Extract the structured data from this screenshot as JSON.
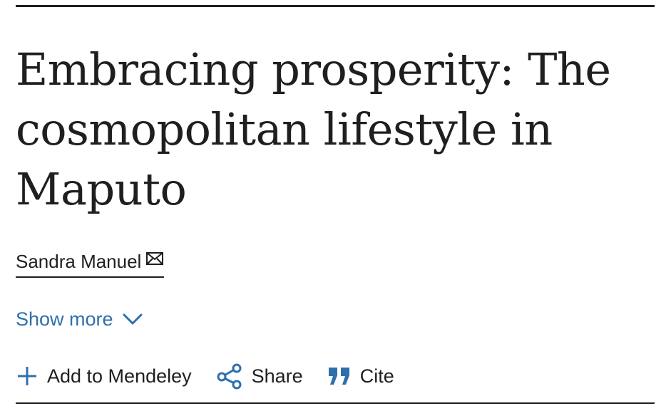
{
  "article": {
    "title": "Embracing prosperity: The cosmopolitan lifestyle in Maputo"
  },
  "author": {
    "name": "Sandra Manuel",
    "icon": "envelope-icon"
  },
  "show_more": {
    "label": "Show more",
    "icon": "chevron-down-icon"
  },
  "actions": {
    "mendeley": {
      "label": "Add to Mendeley",
      "icon": "plus-icon"
    },
    "share": {
      "label": "Share",
      "icon": "share-icon"
    },
    "cite": {
      "label": "Cite",
      "icon": "quote-icon"
    }
  },
  "colors": {
    "text": "#1f1f1f",
    "link": "#2e6fad"
  }
}
